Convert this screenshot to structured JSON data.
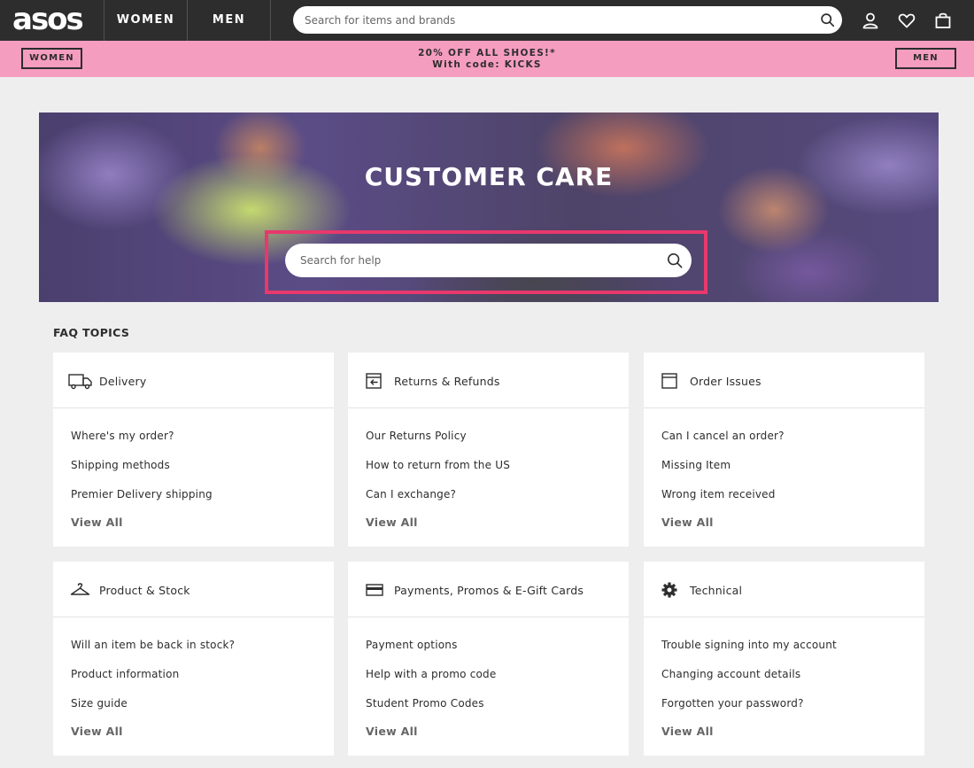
{
  "header": {
    "logo": "asos",
    "tabs": [
      "WOMEN",
      "MEN"
    ],
    "search_placeholder": "Search for items and brands"
  },
  "promo": {
    "left_button": "WOMEN",
    "right_button": "MEN",
    "line1": "20% OFF ALL SHOES!*",
    "line2": "With code: KICKS"
  },
  "hero": {
    "title": "CUSTOMER CARE",
    "search_placeholder": "Search for help"
  },
  "faq": {
    "heading": "FAQ TOPICS",
    "cards": [
      {
        "title": "Delivery",
        "icon": "truck-icon",
        "links": [
          "Where's my order?",
          "Shipping methods",
          "Premier Delivery shipping"
        ],
        "view_all": "View All"
      },
      {
        "title": "Returns & Refunds",
        "icon": "return-box-icon",
        "links": [
          "Our Returns Policy",
          "How to return from the US",
          "Can I exchange?"
        ],
        "view_all": "View All"
      },
      {
        "title": "Order Issues",
        "icon": "order-box-icon",
        "links": [
          "Can I cancel an order?",
          "Missing Item",
          "Wrong item received"
        ],
        "view_all": "View All"
      },
      {
        "title": "Product & Stock",
        "icon": "hanger-icon",
        "links": [
          "Will an item be back in stock?",
          "Product information",
          "Size guide"
        ],
        "view_all": "View All"
      },
      {
        "title": "Payments, Promos & E-Gift Cards",
        "icon": "credit-card-icon",
        "links": [
          "Payment options",
          "Help with a promo code",
          "Student Promo Codes"
        ],
        "view_all": "View All"
      },
      {
        "title": "Technical",
        "icon": "gear-icon",
        "links": [
          "Trouble signing into my account",
          "Changing account details",
          "Forgotten your password?"
        ],
        "view_all": "View All"
      }
    ]
  },
  "colors": {
    "nav_bg": "#2d2d2d",
    "promo_bg": "#f59dbf",
    "highlight": "#e8386c",
    "page_bg": "#eeeeee"
  }
}
